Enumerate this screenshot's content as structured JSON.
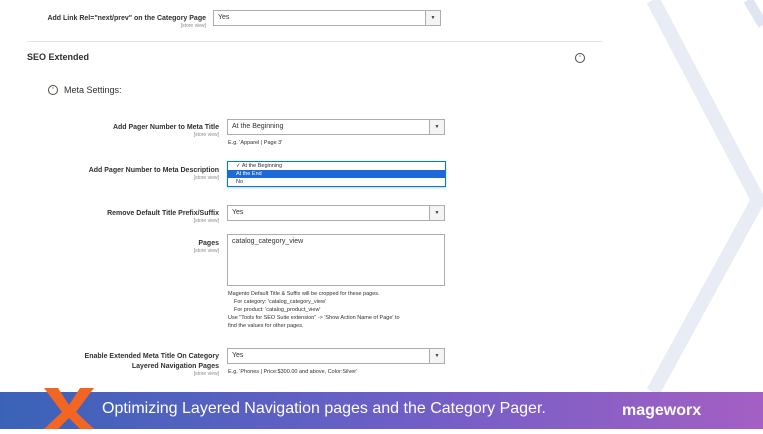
{
  "top": {
    "label": "Add Link Rel=\"next/prev\" on the Category Page",
    "scope": "[store view]",
    "value": "Yes"
  },
  "section": {
    "title": "SEO Extended"
  },
  "meta_settings": {
    "title": "Meta Settings:"
  },
  "fields": {
    "pager_title": {
      "label": "Add Pager Number to Meta Title",
      "scope": "[store view]",
      "value": "At the Beginning",
      "hint": "E.g. 'Apparel | Page 3'"
    },
    "pager_desc": {
      "label": "Add Pager Number to Meta Description",
      "scope": "[store view]",
      "options": [
        "At the Beginning",
        "At the End",
        "No"
      ],
      "selected_index": 1
    },
    "remove_default": {
      "label": "Remove Default Title Prefix/Suffix",
      "scope": "[store view]",
      "value": "Yes"
    },
    "pages": {
      "label": "Pages",
      "scope": "[store view]",
      "value": "catalog_category_view",
      "note": [
        "Magento Default Title & Suffix will be cropped for these pages.",
        "For category: 'catalog_category_view'",
        "For product: 'catalog_product_view'",
        "Use \"Tools for SEO Suite extension\" -> 'Show Action Name of Page' to",
        "find the values for other pages."
      ]
    },
    "extended_title": {
      "label_line1": "Enable Extended Meta Title On Category",
      "label_line2": "Layered Navigation Pages",
      "scope": "[store view]",
      "value": "Yes",
      "hint": "E.g. 'Phones | Price:$300.00 and above, Color:Silver'"
    }
  },
  "banner": {
    "text": "Optimizing Layered Navigation pages and the Category Pager.",
    "brand": "mageworx"
  },
  "colors": {
    "accent_orange": "#f26522",
    "selection_blue": "#1e69d7"
  }
}
